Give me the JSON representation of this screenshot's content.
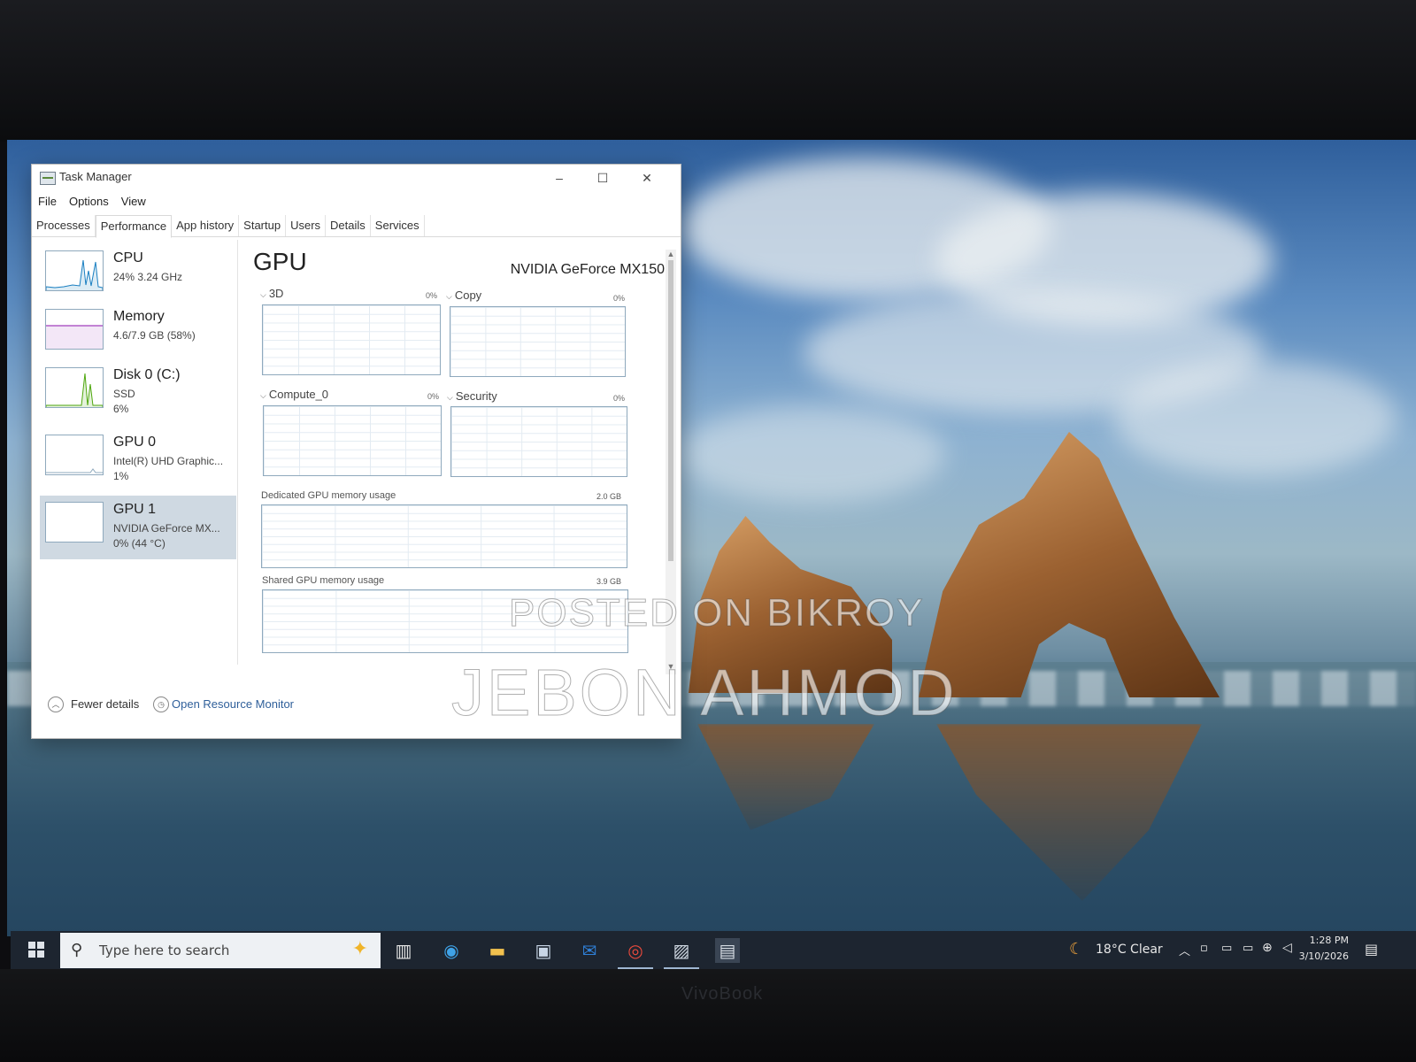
{
  "window": {
    "title": "Task Manager",
    "controls": {
      "minimize": "–",
      "maximize": "☐",
      "close": "✕"
    },
    "menu": [
      "File",
      "Options",
      "View"
    ],
    "tabs": [
      "Processes",
      "Performance",
      "App history",
      "Startup",
      "Users",
      "Details",
      "Services"
    ],
    "active_tab": "Performance"
  },
  "sidebar": {
    "items": [
      {
        "name": "CPU",
        "lines": [
          "24% 3.24 GHz"
        ]
      },
      {
        "name": "Memory",
        "lines": [
          "4.6/7.9 GB (58%)"
        ]
      },
      {
        "name": "Disk 0 (C:)",
        "lines": [
          "SSD",
          "6%"
        ]
      },
      {
        "name": "GPU 0",
        "lines": [
          "Intel(R) UHD Graphic...",
          "1%"
        ]
      },
      {
        "name": "GPU 1",
        "lines": [
          "NVIDIA GeForce MX...",
          "0% (44 °C)"
        ],
        "selected": true
      }
    ]
  },
  "panel": {
    "title": "GPU",
    "device": "NVIDIA GeForce MX150",
    "engines": [
      {
        "label": "3D",
        "percent": "0%"
      },
      {
        "label": "Copy",
        "percent": "0%"
      },
      {
        "label": "Compute_0",
        "percent": "0%"
      },
      {
        "label": "Security",
        "percent": "0%"
      }
    ],
    "dedicated": {
      "label": "Dedicated GPU memory usage",
      "max": "2.0 GB"
    },
    "shared": {
      "label": "Shared GPU memory usage",
      "max": "3.9 GB"
    }
  },
  "footer": {
    "fewer_details": "Fewer details",
    "resource_monitor": "Open Resource Monitor"
  },
  "watermark": {
    "line1": "POSTED ON BIKROY",
    "line2": "JEBON AHMOD"
  },
  "taskbar": {
    "search_placeholder": "Type here to search",
    "weather": "18°C  Clear",
    "time": "1:28 PM",
    "date": "3/10/2026",
    "icons": [
      "task-view-icon",
      "edge-icon",
      "file-explorer-icon",
      "store-icon",
      "outlook-icon",
      "chrome-icon",
      "photos-icon",
      "task-manager-icon"
    ]
  },
  "bezel_brand": "VivoBook"
}
